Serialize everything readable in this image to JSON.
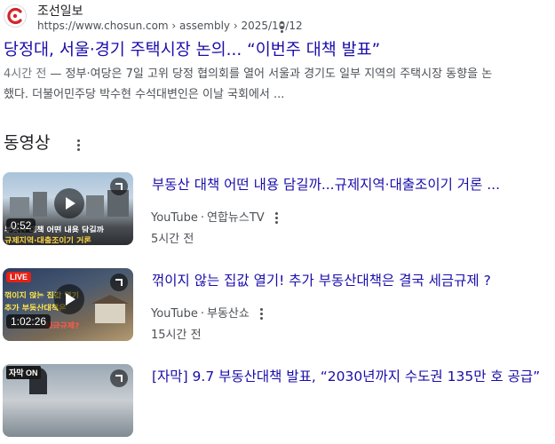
{
  "result": {
    "site_name": "조선일보",
    "url": "https://www.chosun.com › assembly › 2025/10/12",
    "title": "당정대, 서울·경기 주택시장 논의... “이번주 대책 발표”",
    "snippet_time": "4시간 전",
    "snippet_line1": " — 정부·여당은 7일 고위 당정 협의회를 열어 서울과 경기도 일부 지역의 주택시장 동향을 논",
    "snippet_line2": "했다. 더불어민주당 박수현 수석대변인은 이날 국회에서 ..."
  },
  "videos_section": {
    "header": "동영상",
    "items": [
      {
        "title": "부동산 대책 어떤 내용 담길까...규제지역·대출조이기 거론 ...",
        "source": "YouTube",
        "channel": "연합뉴스TV",
        "time": "5시간 전",
        "duration": "0:52",
        "caption_top": "부동산 대책 어떤 내용 담길까",
        "caption_bottom": "규제지역·대출조이기 거론"
      },
      {
        "title": "꺾이지 않는 집값 열기! 추가 부동산대책은 결국 세금규제 ?",
        "source": "YouTube",
        "channel": "부동산쇼",
        "time": "15시간 전",
        "duration": "1:02:26",
        "badge": "LIVE",
        "caption_top": "꺾이지 않는 집값 열기",
        "caption_mid": "추가 부동산대책은",
        "caption_bottom": "세금규제?"
      },
      {
        "title": "[자막] 9.7 부동산대책 발표, “2030년까지 수도권 135만 호 공급”",
        "badge": "자막 ON"
      }
    ]
  },
  "colors": {
    "link": "#1a0dab",
    "text": "#202124",
    "muted": "#4d5156",
    "live": "#e62117"
  }
}
